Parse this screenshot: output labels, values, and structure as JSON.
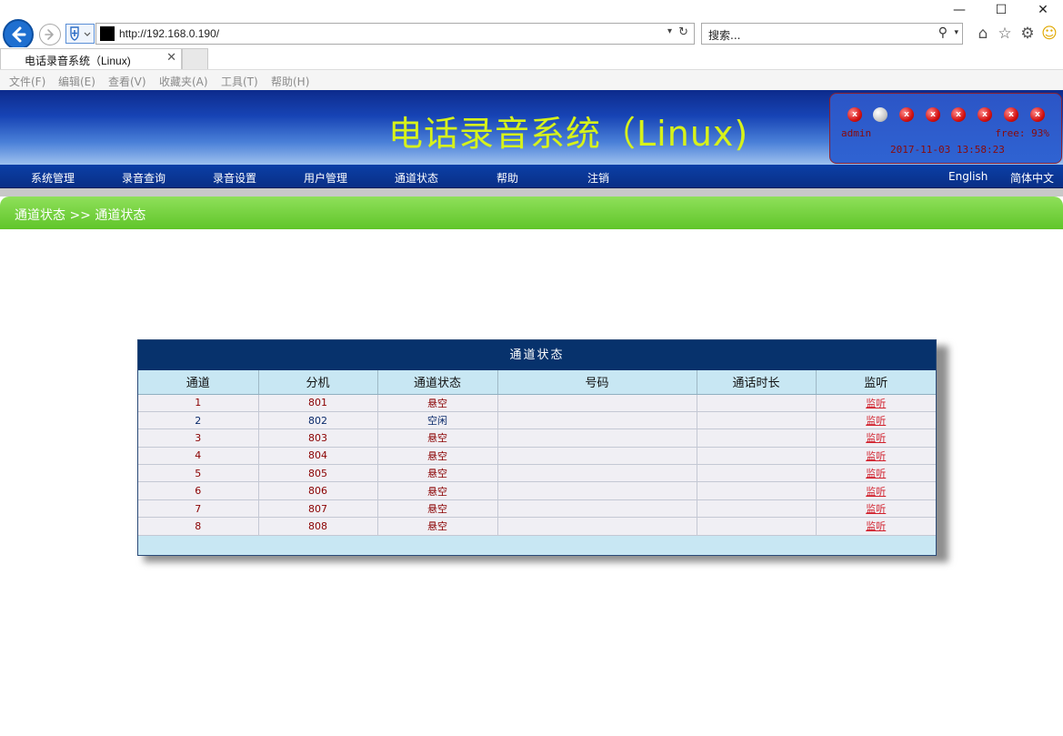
{
  "browser": {
    "window_controls": {
      "minimize": "—",
      "maximize": "☐",
      "close": "✕"
    },
    "url": "http://192.168.0.190/",
    "search_placeholder": "搜索...",
    "tab_title": "电话录音系统（Linux)",
    "menu": [
      "文件(F)",
      "编辑(E)",
      "查看(V)",
      "收藏夹(A)",
      "工具(T)",
      "帮助(H)"
    ]
  },
  "header": {
    "title": "电话录音系统（Linux)",
    "channel_indicators": [
      "error",
      "idle",
      "error",
      "error",
      "error",
      "error",
      "error",
      "error"
    ],
    "user": "admin",
    "free": "free: 93%",
    "datetime": "2017-11-03 13:58:23"
  },
  "nav": {
    "items": [
      "系统管理",
      "录音查询",
      "录音设置",
      "用户管理",
      "通道状态",
      "帮助",
      "注销"
    ],
    "lang_en": "English",
    "lang_zh": "简体中文"
  },
  "breadcrumb": "通道状态 >> 通道状态",
  "table": {
    "title": "通道状态",
    "columns": [
      "通道",
      "分机",
      "通道状态",
      "号码",
      "通话时长",
      "监听"
    ],
    "rows": [
      {
        "channel": "1",
        "ext": "801",
        "status": "悬空",
        "number": "",
        "duration": "",
        "listen": "监听"
      },
      {
        "channel": "2",
        "ext": "802",
        "status": "空闲",
        "number": "",
        "duration": "",
        "listen": "监听"
      },
      {
        "channel": "3",
        "ext": "803",
        "status": "悬空",
        "number": "",
        "duration": "",
        "listen": "监听"
      },
      {
        "channel": "4",
        "ext": "804",
        "status": "悬空",
        "number": "",
        "duration": "",
        "listen": "监听"
      },
      {
        "channel": "5",
        "ext": "805",
        "status": "悬空",
        "number": "",
        "duration": "",
        "listen": "监听"
      },
      {
        "channel": "6",
        "ext": "806",
        "status": "悬空",
        "number": "",
        "duration": "",
        "listen": "监听"
      },
      {
        "channel": "7",
        "ext": "807",
        "status": "悬空",
        "number": "",
        "duration": "",
        "listen": "监听"
      },
      {
        "channel": "8",
        "ext": "808",
        "status": "悬空",
        "number": "",
        "duration": "",
        "listen": "监听"
      }
    ]
  },
  "colors": {
    "header_title": "#d7f21a",
    "table_header": "#07326c",
    "breadcrumb_green": "#60c52a",
    "status_red": "#8a0000",
    "status_idle": "#0a2a6a",
    "link_red": "#d11f2b"
  }
}
